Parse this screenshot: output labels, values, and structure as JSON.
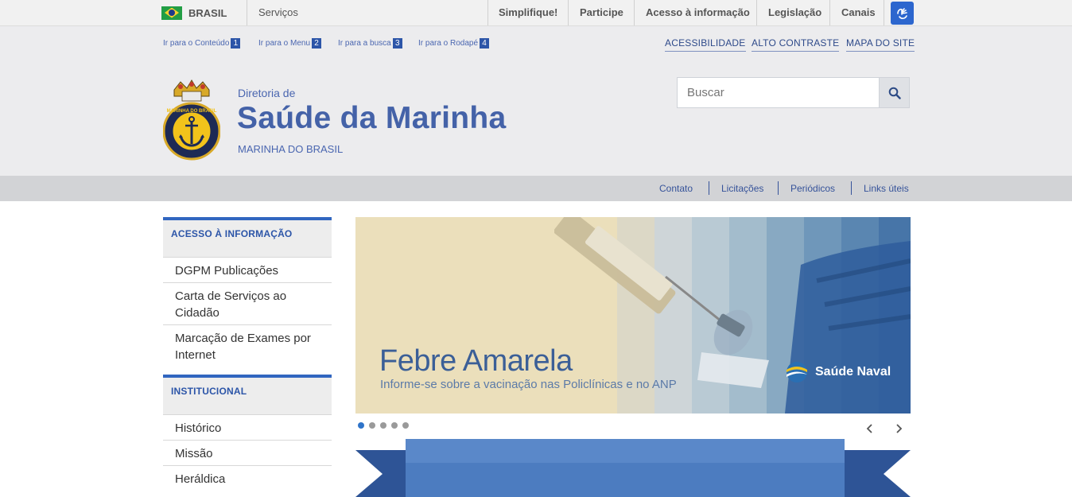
{
  "gov_bar": {
    "brasil": "BRASIL",
    "servicos": "Serviços",
    "links": [
      "Simplifique!",
      "Participe",
      "Acesso à informação",
      "Legislação",
      "Canais"
    ]
  },
  "skip_links": [
    {
      "label": "Ir para o Conteúdo",
      "num": "1"
    },
    {
      "label": "Ir para o Menu",
      "num": "2"
    },
    {
      "label": "Ir para a busca",
      "num": "3"
    },
    {
      "label": "Ir para o Rodapé",
      "num": "4"
    }
  ],
  "accessibility_links": [
    "ACESSIBILIDADE",
    "ALTO CONTRASTE",
    "MAPA DO SITE"
  ],
  "site": {
    "pre_title": "Diretoria de",
    "title": "Saúde da Marinha",
    "subtitle": "MARINHA DO BRASIL",
    "emblem_text": "MARINHA DO BRASIL"
  },
  "search": {
    "placeholder": "Buscar"
  },
  "service_links": [
    "Contato",
    "Licitações",
    "Periódicos",
    "Links úteis"
  ],
  "sidebar": {
    "sections": [
      {
        "title": "ACESSO À INFORMAÇÃO",
        "items": [
          "DGPM Publicações",
          "Carta de Serviços ao Cidadão",
          "Marcação de Exames por Internet"
        ]
      },
      {
        "title": "INSTITUCIONAL",
        "items": [
          "Histórico",
          "Missão",
          "Heráldica"
        ]
      }
    ]
  },
  "carousel": {
    "title": "Febre Amarela",
    "subtitle": "Informe-se sobre a vacinação nas Policlínicas e no ANP",
    "brand": "Saúde Naval",
    "slide_count": 5,
    "active_slide": 1
  },
  "colors": {
    "brand_blue": "#4462a8",
    "accent_blue": "#3166c0",
    "header_bg": "#ececee",
    "service_bar_bg": "#d2d3d6"
  }
}
